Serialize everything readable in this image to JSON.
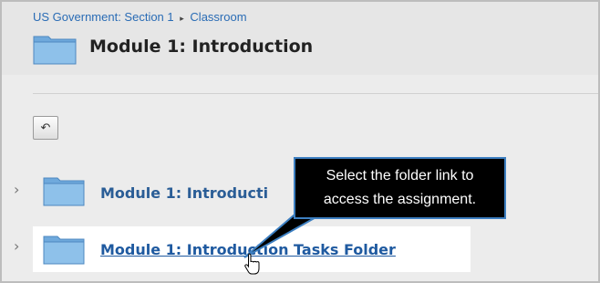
{
  "breadcrumb": {
    "course": "US Government: Section 1",
    "separator": "▸",
    "page": "Classroom"
  },
  "header": {
    "title": "Module 1: Introduction"
  },
  "toolbar": {
    "back_symbol": "↶"
  },
  "list": {
    "items": [
      {
        "expander": "›",
        "label": "Module 1: Introducti"
      },
      {
        "expander": "›",
        "label": "Module 1: Introduction Tasks Folder"
      }
    ]
  },
  "callout": {
    "line1": "Select the folder link to",
    "line2": "access the assignment."
  },
  "icons": {
    "folder": "folder-icon",
    "back": "back-arrow-icon",
    "cursor": "hand-pointer-icon"
  },
  "colors": {
    "link": "#2a5d96",
    "callout_bg": "#000000",
    "callout_border": "#3d7fc1"
  }
}
